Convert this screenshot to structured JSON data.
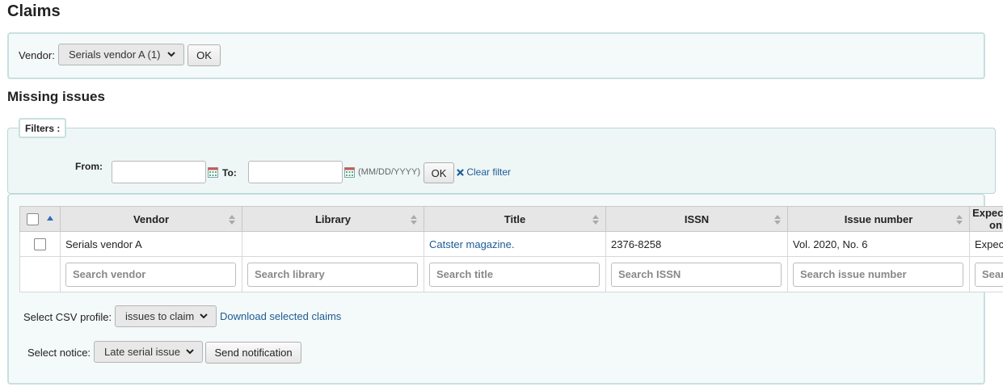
{
  "page": {
    "title": "Claims"
  },
  "vendor_select": {
    "label": "Vendor:",
    "selected": "Serials vendor A (1)",
    "ok_label": "OK"
  },
  "missing": {
    "heading": "Missing issues",
    "filters": {
      "legend": "Filters :",
      "from_label": "From:",
      "to_label": "To:",
      "date_format": "(MM/DD/YYYY)",
      "ok_label": "OK",
      "clear_label": "Clear filter",
      "from_value": "",
      "to_value": ""
    },
    "table": {
      "columns": [
        "Vendor",
        "Library",
        "Title",
        "ISSN",
        "Issue number",
        "Expected on"
      ],
      "rows": [
        {
          "vendor": "Serials vendor A",
          "library": "",
          "title": "Catster magazine.",
          "issn": "2376-8258",
          "issue_number": "Vol. 2020, No. 6",
          "expected": "Expected"
        }
      ],
      "search_placeholders": [
        "Search vendor",
        "Search library",
        "Search title",
        "Search ISSN",
        "Search issue number",
        "Search"
      ]
    },
    "csv": {
      "label": "Select CSV profile:",
      "selected": "issues to claim",
      "download_label": "Download selected claims"
    },
    "notice": {
      "label": "Select notice:",
      "selected": "Late serial issue",
      "send_label": "Send notification"
    }
  },
  "colors": {
    "link": "#1d5c95",
    "panel_border": "#c8e0e0",
    "panel_bg": "#f4f9f9"
  }
}
